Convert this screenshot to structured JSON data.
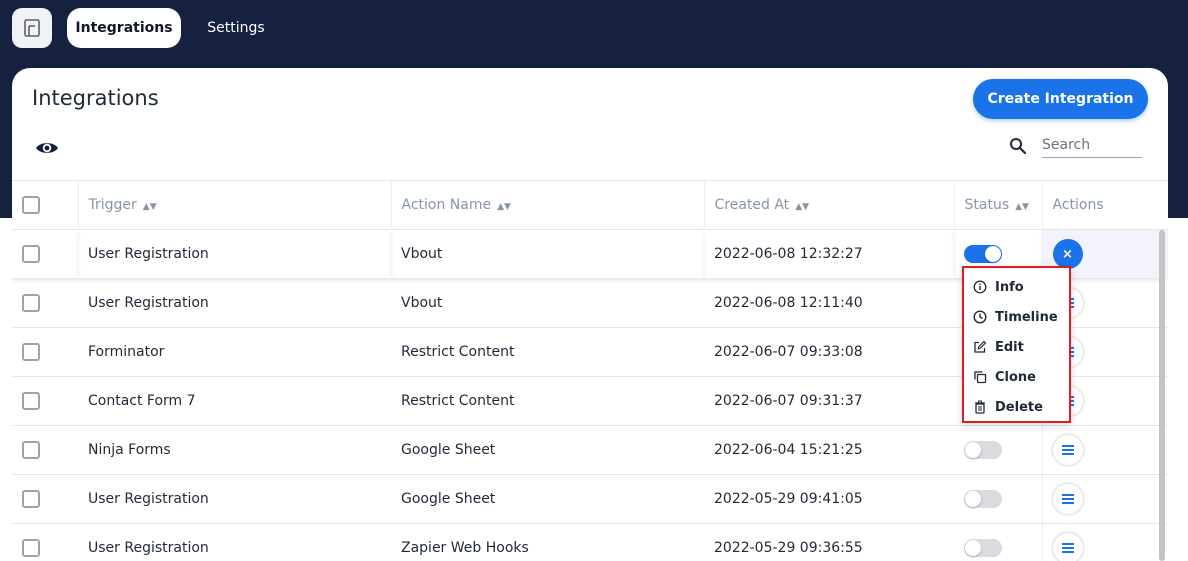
{
  "nav": {
    "logo_icon": "logo-icon",
    "tabs": [
      {
        "label": "Integrations",
        "active": true
      },
      {
        "label": "Settings",
        "active": false
      }
    ]
  },
  "page": {
    "title": "Integrations",
    "create_label": "Create Integration",
    "search_placeholder": "Search"
  },
  "table": {
    "columns": [
      "Trigger",
      "Action Name",
      "Created At",
      "Status",
      "Actions"
    ],
    "rows": [
      {
        "trigger": "User Registration",
        "action": "Vbout",
        "created": "2022-06-08 12:32:27",
        "status_on": true
      },
      {
        "trigger": "User Registration",
        "action": "Vbout",
        "created": "2022-06-08 12:11:40",
        "status_on": false
      },
      {
        "trigger": "Forminator",
        "action": "Restrict Content",
        "created": "2022-06-07 09:33:08",
        "status_on": false
      },
      {
        "trigger": "Contact Form 7",
        "action": "Restrict Content",
        "created": "2022-06-07 09:31:37",
        "status_on": false
      },
      {
        "trigger": "Ninja Forms",
        "action": "Google Sheet",
        "created": "2022-06-04 15:21:25",
        "status_on": false
      },
      {
        "trigger": "User Registration",
        "action": "Google Sheet",
        "created": "2022-05-29 09:41:05",
        "status_on": false
      },
      {
        "trigger": "User Registration",
        "action": "Zapier Web Hooks",
        "created": "2022-05-29 09:36:55",
        "status_on": false
      }
    ]
  },
  "menu": {
    "close_glyph": "×",
    "items": [
      {
        "label": "Info",
        "icon": "info-icon"
      },
      {
        "label": "Timeline",
        "icon": "clock-icon"
      },
      {
        "label": "Edit",
        "icon": "edit-icon"
      },
      {
        "label": "Clone",
        "icon": "clone-icon"
      },
      {
        "label": "Delete",
        "icon": "trash-icon"
      }
    ]
  },
  "colors": {
    "nav_bg": "#16213f",
    "primary": "#1a73e8",
    "highlight_border": "#e11d24"
  }
}
